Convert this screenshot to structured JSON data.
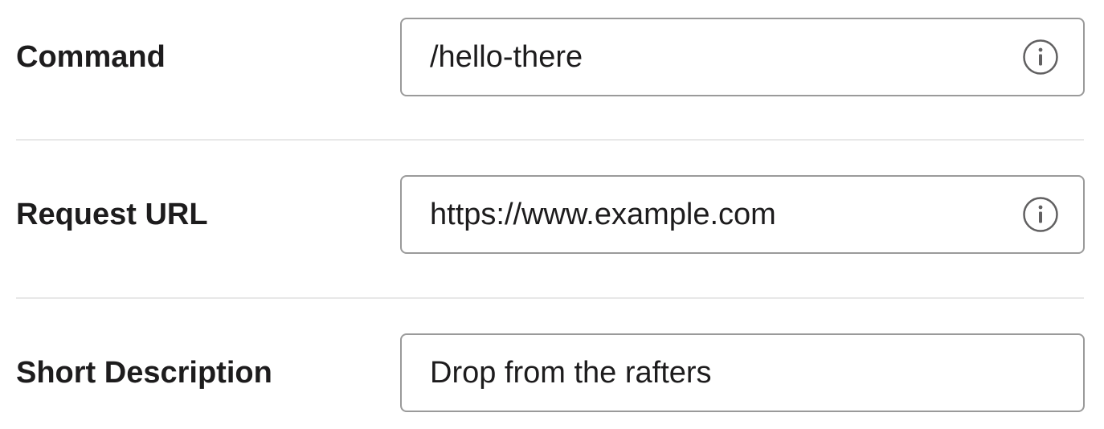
{
  "form": {
    "command": {
      "label": "Command",
      "value": "/hello-there",
      "icon": "info-icon"
    },
    "request_url": {
      "label": "Request URL",
      "value": "https://www.example.com",
      "icon": "info-icon"
    },
    "short_description": {
      "label": "Short Description",
      "value": "Drop from the rafters"
    }
  },
  "colors": {
    "text": "#1d1c1d",
    "field_border": "#9a9a9a",
    "divider": "#e8e8e8",
    "icon": "#616061"
  }
}
